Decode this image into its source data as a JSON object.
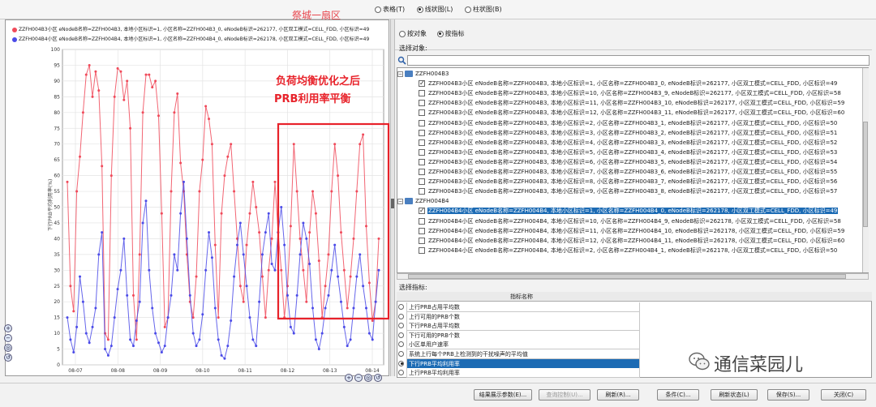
{
  "toolbar": {
    "chart_types": [
      {
        "label": "表格(T)",
        "selected": false
      },
      {
        "label": "线状图(L)",
        "selected": true
      },
      {
        "label": "柱状图(B)",
        "selected": false
      }
    ]
  },
  "chart": {
    "title": "祭城一扇区",
    "legend": [
      {
        "color": "#f04a5a",
        "text": "ZZFH004B3小区 eNodeB名称=ZZFH004B3, 本地小区标识=1, 小区名称=ZZFH004B3_0, eNodeB标识=262177, 小区双工模式=CELL_FDD, 小区标识=49"
      },
      {
        "color": "#4a4ae8",
        "text": "ZZFH004B4小区 eNodeB名称=ZZFH004B4, 本地小区标识=1, 小区名称=ZZFH004B4_0, eNodeB标识=262178, 小区双工模式=CELL_FDD, 小区标识=49"
      }
    ],
    "annotation_line1": "负荷均衡优化之后",
    "annotation_line2": "PRB利用率平衡",
    "ylabel": "下行PRB平均利用率(%)"
  },
  "chart_data": {
    "type": "line",
    "x": [
      "08-07",
      "08-08",
      "08-09",
      "08-10",
      "08-11",
      "08-12",
      "08-13",
      "08-14"
    ],
    "ylim": [
      0,
      100
    ],
    "yticks": [
      0,
      5,
      10,
      15,
      20,
      25,
      30,
      35,
      40,
      45,
      50,
      55,
      60,
      65,
      70,
      75,
      80,
      85,
      90,
      95,
      100
    ],
    "grid": true,
    "series": [
      {
        "name": "ZZFH004B3",
        "color": "#f04a5a",
        "values": [
          58,
          25,
          17,
          55,
          66,
          80,
          92,
          95,
          85,
          93,
          87,
          63,
          10,
          8,
          60,
          85,
          94,
          93,
          84,
          90,
          75,
          22,
          8,
          35,
          80,
          92,
          92,
          88,
          90,
          79,
          48,
          12,
          15,
          55,
          80,
          86,
          64,
          55,
          35,
          20,
          15,
          28,
          55,
          65,
          82,
          78,
          70,
          38,
          15,
          48,
          60,
          66,
          70,
          55,
          40,
          25,
          20,
          38,
          48,
          58,
          50,
          42,
          28,
          15,
          30,
          40,
          58,
          42,
          30,
          15,
          25,
          44,
          70,
          55,
          40,
          30,
          20,
          42,
          55,
          48,
          33,
          15,
          25,
          35,
          55,
          70,
          60,
          42,
          30,
          18,
          28,
          40,
          55,
          70,
          73,
          44,
          26,
          14,
          20,
          40
        ]
      },
      {
        "name": "ZZFH004B4",
        "color": "#4a4ae8",
        "values": [
          15,
          8,
          4,
          12,
          28,
          20,
          10,
          7,
          12,
          18,
          35,
          42,
          5,
          3,
          6,
          15,
          24,
          30,
          40,
          22,
          8,
          6,
          14,
          20,
          45,
          52,
          30,
          18,
          10,
          7,
          4,
          6,
          15,
          22,
          35,
          30,
          48,
          58,
          40,
          22,
          10,
          6,
          8,
          16,
          30,
          42,
          34,
          18,
          8,
          3,
          2,
          6,
          14,
          28,
          38,
          45,
          35,
          25,
          15,
          8,
          6,
          20,
          35,
          42,
          48,
          32,
          30,
          42,
          50,
          38,
          22,
          12,
          10,
          22,
          35,
          45,
          40,
          32,
          18,
          8,
          5,
          10,
          18,
          22,
          30,
          38,
          28,
          20,
          12,
          6,
          8,
          18,
          28,
          35,
          25,
          18,
          10,
          8,
          20,
          30
        ]
      }
    ]
  },
  "right": {
    "object_radios": [
      {
        "label": "按对象",
        "selected": false
      },
      {
        "label": "按指标",
        "selected": true
      }
    ],
    "select_object_title": "选择对象:",
    "tree": [
      {
        "type": "group",
        "label": "ZZFH004B3"
      },
      {
        "type": "leaf",
        "checked": true,
        "selected": false,
        "label": "ZZFH004B3小区 eNodeB名称=ZZFH004B3, 本地小区标识=1, 小区名称=ZZFH004B3_0, eNodeB标识=262177, 小区双工模式=CELL_FDD, 小区标识=49"
      },
      {
        "type": "leaf",
        "checked": false,
        "selected": false,
        "label": "ZZFH004B3小区 eNodeB名称=ZZFH004B3, 本地小区标识=10, 小区名称=ZZFH004B3_9, eNodeB标识=262177, 小区双工模式=CELL_FDD, 小区标识=58"
      },
      {
        "type": "leaf",
        "checked": false,
        "selected": false,
        "label": "ZZFH004B3小区 eNodeB名称=ZZFH004B3, 本地小区标识=11, 小区名称=ZZFH004B3_10, eNodeB标识=262177, 小区双工模式=CELL_FDD, 小区标识=59"
      },
      {
        "type": "leaf",
        "checked": false,
        "selected": false,
        "label": "ZZFH004B3小区 eNodeB名称=ZZFH004B3, 本地小区标识=12, 小区名称=ZZFH004B3_11, eNodeB标识=262177, 小区双工模式=CELL_FDD, 小区标识=60"
      },
      {
        "type": "leaf",
        "checked": false,
        "selected": false,
        "label": "ZZFH004B3小区 eNodeB名称=ZZFH004B3, 本地小区标识=2, 小区名称=ZZFH004B3_1, eNodeB标识=262177, 小区双工模式=CELL_FDD, 小区标识=50"
      },
      {
        "type": "leaf",
        "checked": false,
        "selected": false,
        "label": "ZZFH004B3小区 eNodeB名称=ZZFH004B3, 本地小区标识=3, 小区名称=ZZFH004B3_2, eNodeB标识=262177, 小区双工模式=CELL_FDD, 小区标识=51"
      },
      {
        "type": "leaf",
        "checked": false,
        "selected": false,
        "label": "ZZFH004B3小区 eNodeB名称=ZZFH004B3, 本地小区标识=4, 小区名称=ZZFH004B3_3, eNodeB标识=262177, 小区双工模式=CELL_FDD, 小区标识=52"
      },
      {
        "type": "leaf",
        "checked": false,
        "selected": false,
        "label": "ZZFH004B3小区 eNodeB名称=ZZFH004B3, 本地小区标识=5, 小区名称=ZZFH004B3_4, eNodeB标识=262177, 小区双工模式=CELL_FDD, 小区标识=53"
      },
      {
        "type": "leaf",
        "checked": false,
        "selected": false,
        "label": "ZZFH004B3小区 eNodeB名称=ZZFH004B3, 本地小区标识=6, 小区名称=ZZFH004B3_5, eNodeB标识=262177, 小区双工模式=CELL_FDD, 小区标识=54"
      },
      {
        "type": "leaf",
        "checked": false,
        "selected": false,
        "label": "ZZFH004B3小区 eNodeB名称=ZZFH004B3, 本地小区标识=7, 小区名称=ZZFH004B3_6, eNodeB标识=262177, 小区双工模式=CELL_FDD, 小区标识=55"
      },
      {
        "type": "leaf",
        "checked": false,
        "selected": false,
        "label": "ZZFH004B3小区 eNodeB名称=ZZFH004B3, 本地小区标识=8, 小区名称=ZZFH004B3_7, eNodeB标识=262177, 小区双工模式=CELL_FDD, 小区标识=56"
      },
      {
        "type": "leaf",
        "checked": false,
        "selected": false,
        "label": "ZZFH004B3小区 eNodeB名称=ZZFH004B3, 本地小区标识=9, 小区名称=ZZFH004B3_8, eNodeB标识=262177, 小区双工模式=CELL_FDD, 小区标识=57"
      },
      {
        "type": "group",
        "label": "ZZFH004B4"
      },
      {
        "type": "leaf",
        "checked": true,
        "selected": true,
        "label": "ZZFH004B4小区 eNodeB名称=ZZFH004B4, 本地小区标识=1, 小区名称=ZZFH004B4_0, eNodeB标识=262178, 小区双工模式=CELL_FDD, 小区标识=49"
      },
      {
        "type": "leaf",
        "checked": false,
        "selected": false,
        "label": "ZZFH004B4小区 eNodeB名称=ZZFH004B4, 本地小区标识=10, 小区名称=ZZFH004B4_9, eNodeB标识=262178, 小区双工模式=CELL_FDD, 小区标识=58"
      },
      {
        "type": "leaf",
        "checked": false,
        "selected": false,
        "label": "ZZFH004B4小区 eNodeB名称=ZZFH004B4, 本地小区标识=11, 小区名称=ZZFH004B4_10, eNodeB标识=262178, 小区双工模式=CELL_FDD, 小区标识=59"
      },
      {
        "type": "leaf",
        "checked": false,
        "selected": false,
        "label": "ZZFH004B4小区 eNodeB名称=ZZFH004B4, 本地小区标识=12, 小区名称=ZZFH004B4_11, eNodeB标识=262178, 小区双工模式=CELL_FDD, 小区标识=60"
      },
      {
        "type": "leaf",
        "checked": false,
        "selected": false,
        "label": "ZZFH004B4小区 eNodeB名称=ZZFH004B4, 本地小区标识=2, 小区名称=ZZFH004B4_1, eNodeB标识=262178, 小区双工模式=CELL_FDD, 小区标识=50"
      }
    ],
    "select_metric_title": "选择指标:",
    "metric_header": "指标名称",
    "metrics": [
      {
        "label": "上行PRB占用平均数",
        "selected": false
      },
      {
        "label": "上行可用的PRB个数",
        "selected": false
      },
      {
        "label": "下行PRB占用平均数",
        "selected": false
      },
      {
        "label": "下行可用的PRB个数",
        "selected": false
      },
      {
        "label": "小区单用户速率",
        "selected": false
      },
      {
        "label": "系统上行每个PRB上检测到的干扰噪声的平均值",
        "selected": false
      },
      {
        "label": "下行PRB平均利用率",
        "selected": true
      },
      {
        "label": "上行PRB平均利用率",
        "selected": false
      }
    ]
  },
  "buttons": [
    {
      "label": "结果展示参数(E)...",
      "disabled": false
    },
    {
      "label": "查询控制(U)...",
      "disabled": true
    },
    {
      "label": "刷新(R)...",
      "disabled": false
    },
    {
      "label": "条件(C)...",
      "disabled": false
    },
    {
      "label": "刷新状态(L)",
      "disabled": false
    },
    {
      "label": "保存(S)...",
      "disabled": false
    },
    {
      "label": "关闭(C)",
      "disabled": false
    }
  ],
  "watermark": "通信菜园儿",
  "colors": {
    "accent": "#1c6bb4",
    "red_series": "#f04a5a",
    "blue_series": "#4a4ae8",
    "annotation": "#e8222a"
  }
}
